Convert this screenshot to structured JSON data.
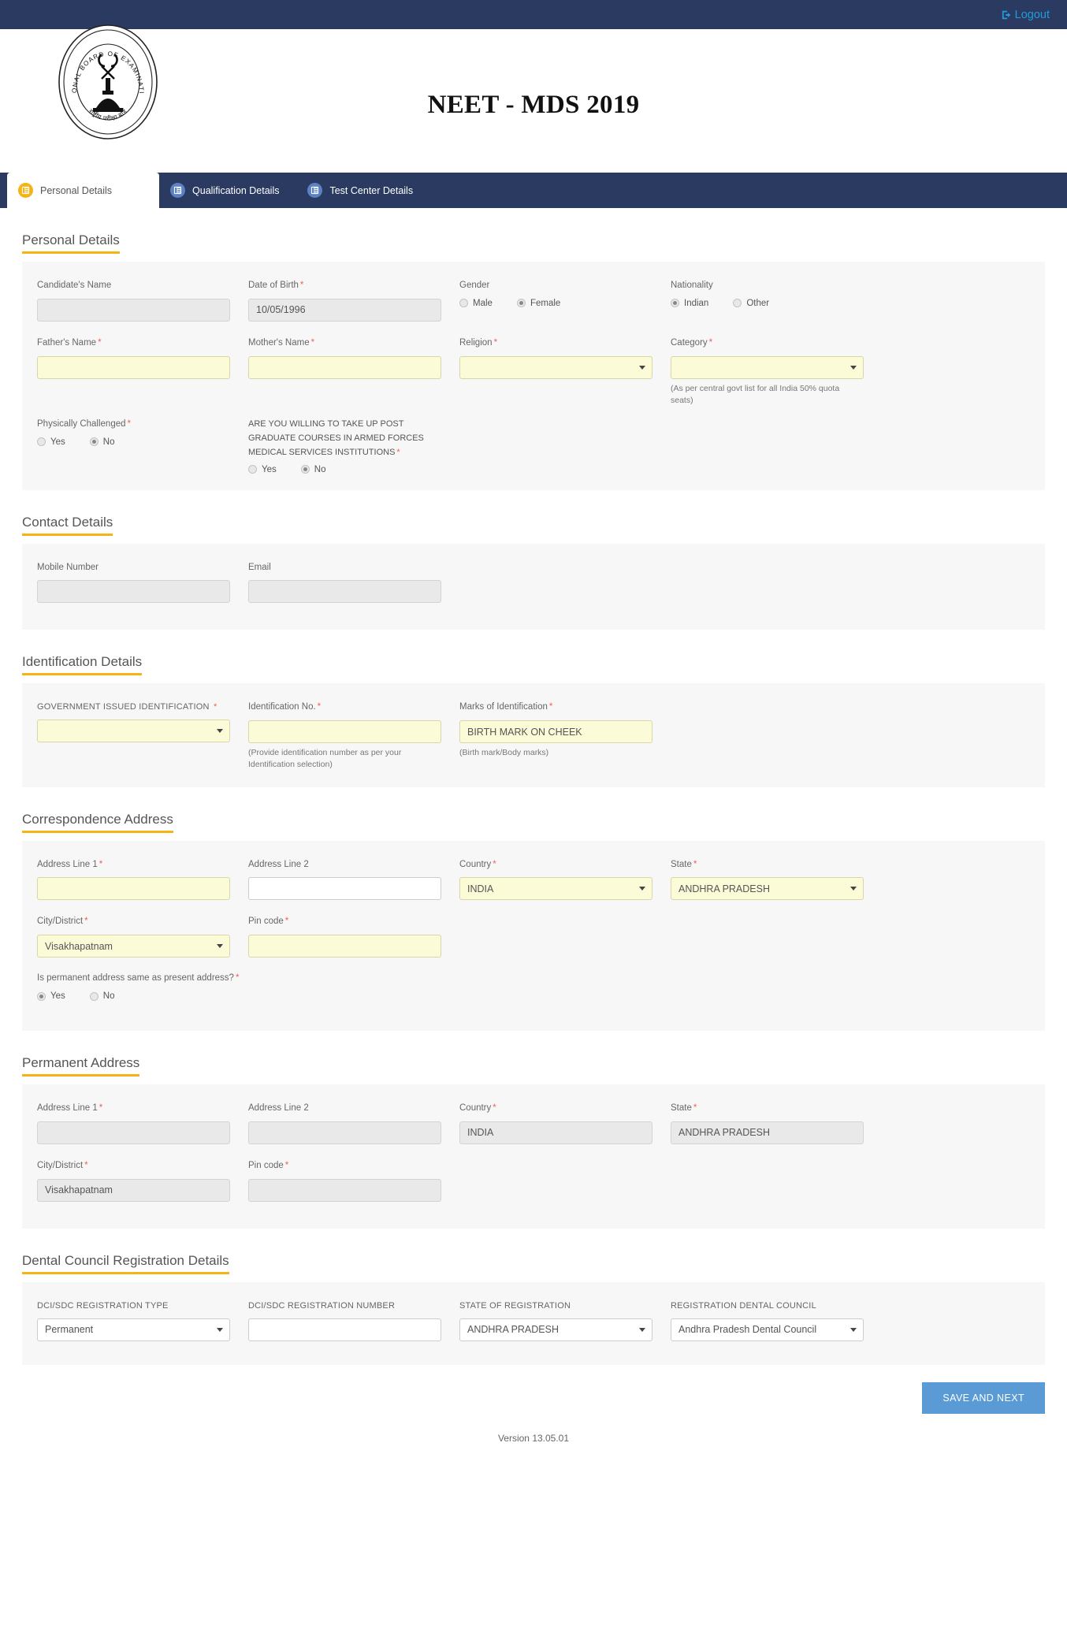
{
  "topbar": {
    "logout_label": "Logout",
    "logout_icon": "sign-out-icon",
    "bg": "#2b3a60",
    "link_color": "#1f9bde"
  },
  "brand": {
    "title": "NEET - MDS 2019",
    "logo_alt": "NATIONAL BOARD OF EXAMINATIONS"
  },
  "tabs": [
    {
      "label": "Personal Details",
      "icon": "form-icon",
      "active": true
    },
    {
      "label": "Qualification Details",
      "icon": "form-icon",
      "active": false
    },
    {
      "label": "Test Center Details",
      "icon": "form-icon",
      "active": false
    }
  ],
  "sections": {
    "personal": {
      "title": "Personal Details",
      "candidate_name": {
        "label": "Candidate's Name",
        "value": ""
      },
      "dob": {
        "label": "Date of Birth",
        "value": "10/05/1996"
      },
      "gender": {
        "label": "Gender",
        "options": [
          "Male",
          "Female"
        ],
        "selected": "Female"
      },
      "nationality": {
        "label": "Nationality",
        "options": [
          "Indian",
          "Other"
        ],
        "selected": "Indian"
      },
      "father_name": {
        "label": "Father's Name",
        "value": ""
      },
      "mother_name": {
        "label": "Mother's Name",
        "value": ""
      },
      "religion": {
        "label": "Religion",
        "value": ""
      },
      "category": {
        "label": "Category",
        "value": "",
        "hint": "(As per central govt list for all India 50% quota seats)"
      },
      "physically_challenged": {
        "label": "Physically Challenged",
        "options": [
          "Yes",
          "No"
        ],
        "selected": "No"
      },
      "armed_forces": {
        "label": "ARE YOU WILLING TO TAKE UP POST GRADUATE COURSES IN ARMED FORCES MEDICAL SERVICES INSTITUTIONS",
        "options": [
          "Yes",
          "No"
        ],
        "selected": "No"
      }
    },
    "contact": {
      "title": "Contact Details",
      "mobile": {
        "label": "Mobile Number",
        "value": ""
      },
      "email": {
        "label": "Email",
        "value": ""
      }
    },
    "identification": {
      "title": "Identification Details",
      "govt_id": {
        "label": "GOVERNMENT ISSUED IDENTIFICATION",
        "value": ""
      },
      "id_no": {
        "label": "Identification No.",
        "value": "",
        "hint": "(Provide identification number as per your Identification selection)"
      },
      "marks": {
        "label": "Marks of Identification",
        "value": "BIRTH MARK ON CHEEK",
        "hint": "(Birth mark/Body marks)"
      }
    },
    "correspondence": {
      "title": "Correspondence Address",
      "address1": {
        "label": "Address Line 1",
        "value": ""
      },
      "address2": {
        "label": "Address Line 2",
        "value": ""
      },
      "country": {
        "label": "Country",
        "value": "INDIA"
      },
      "state": {
        "label": "State",
        "value": "ANDHRA PRADESH"
      },
      "city": {
        "label": "City/District",
        "value": "Visakhapatnam"
      },
      "pincode": {
        "label": "Pin code",
        "value": ""
      },
      "same_address": {
        "label": "Is permanent address same as present address?",
        "options": [
          "Yes",
          "No"
        ],
        "selected": "Yes"
      }
    },
    "permanent": {
      "title": "Permanent Address",
      "address1": {
        "label": "Address Line 1",
        "value": ""
      },
      "address2": {
        "label": "Address Line 2",
        "value": ""
      },
      "country": {
        "label": "Country",
        "value": "INDIA"
      },
      "state": {
        "label": "State",
        "value": "ANDHRA PRADESH"
      },
      "city": {
        "label": "City/District",
        "value": "Visakhapatnam"
      },
      "pincode": {
        "label": "Pin code",
        "value": ""
      }
    },
    "dental": {
      "title": "Dental Council Registration Details",
      "reg_type": {
        "label": "DCI/SDC REGISTRATION TYPE",
        "value": "Permanent"
      },
      "reg_number": {
        "label": "DCI/SDC REGISTRATION NUMBER",
        "value": ""
      },
      "state_of_reg": {
        "label": "STATE OF REGISTRATION",
        "value": "ANDHRA PRADESH"
      },
      "council": {
        "label": "REGISTRATION DENTAL COUNCIL",
        "value": "Andhra Pradesh Dental Council"
      }
    }
  },
  "footer": {
    "save_label": "SAVE AND NEXT",
    "version": "Version 13.05.01"
  }
}
